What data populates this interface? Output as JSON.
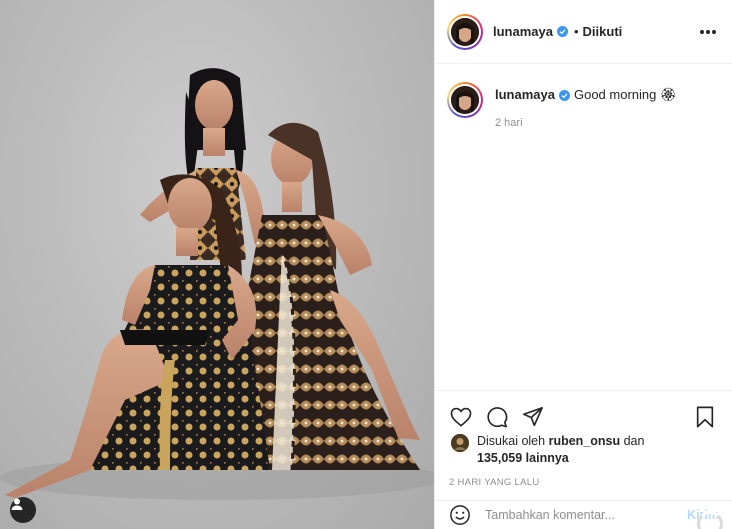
{
  "post": {
    "photo_alt": "",
    "user_tag_icon": "user-silhouette-icon"
  },
  "header": {
    "username": "lunamaya",
    "verified": true,
    "separator": "•",
    "follow_status": "Diikuti",
    "more_icon": "more-dots-icon"
  },
  "caption": {
    "username": "lunamaya",
    "text": "Good morning 🏵",
    "time": "2 hari"
  },
  "actions": {
    "like_icon": "heart-icon",
    "comment_icon": "comment-bubble-icon",
    "share_icon": "paper-plane-icon",
    "save_icon": "bookmark-icon"
  },
  "likes": {
    "prefix": "Disukai oleh",
    "liker": "ruben_onsu",
    "and": "dan",
    "count": "135,059",
    "suffix": "lainnya"
  },
  "post_date": "2 HARI YANG LALU",
  "comment_box": {
    "emoji_icon": "smiley-icon",
    "placeholder": "Tambahkan komentar...",
    "post_label": "Kirim"
  },
  "colors": {
    "link_blue_disabled": "#b3dbff",
    "verified_blue": "#3897f0",
    "text": "#262626",
    "muted": "#8e8e8e"
  }
}
